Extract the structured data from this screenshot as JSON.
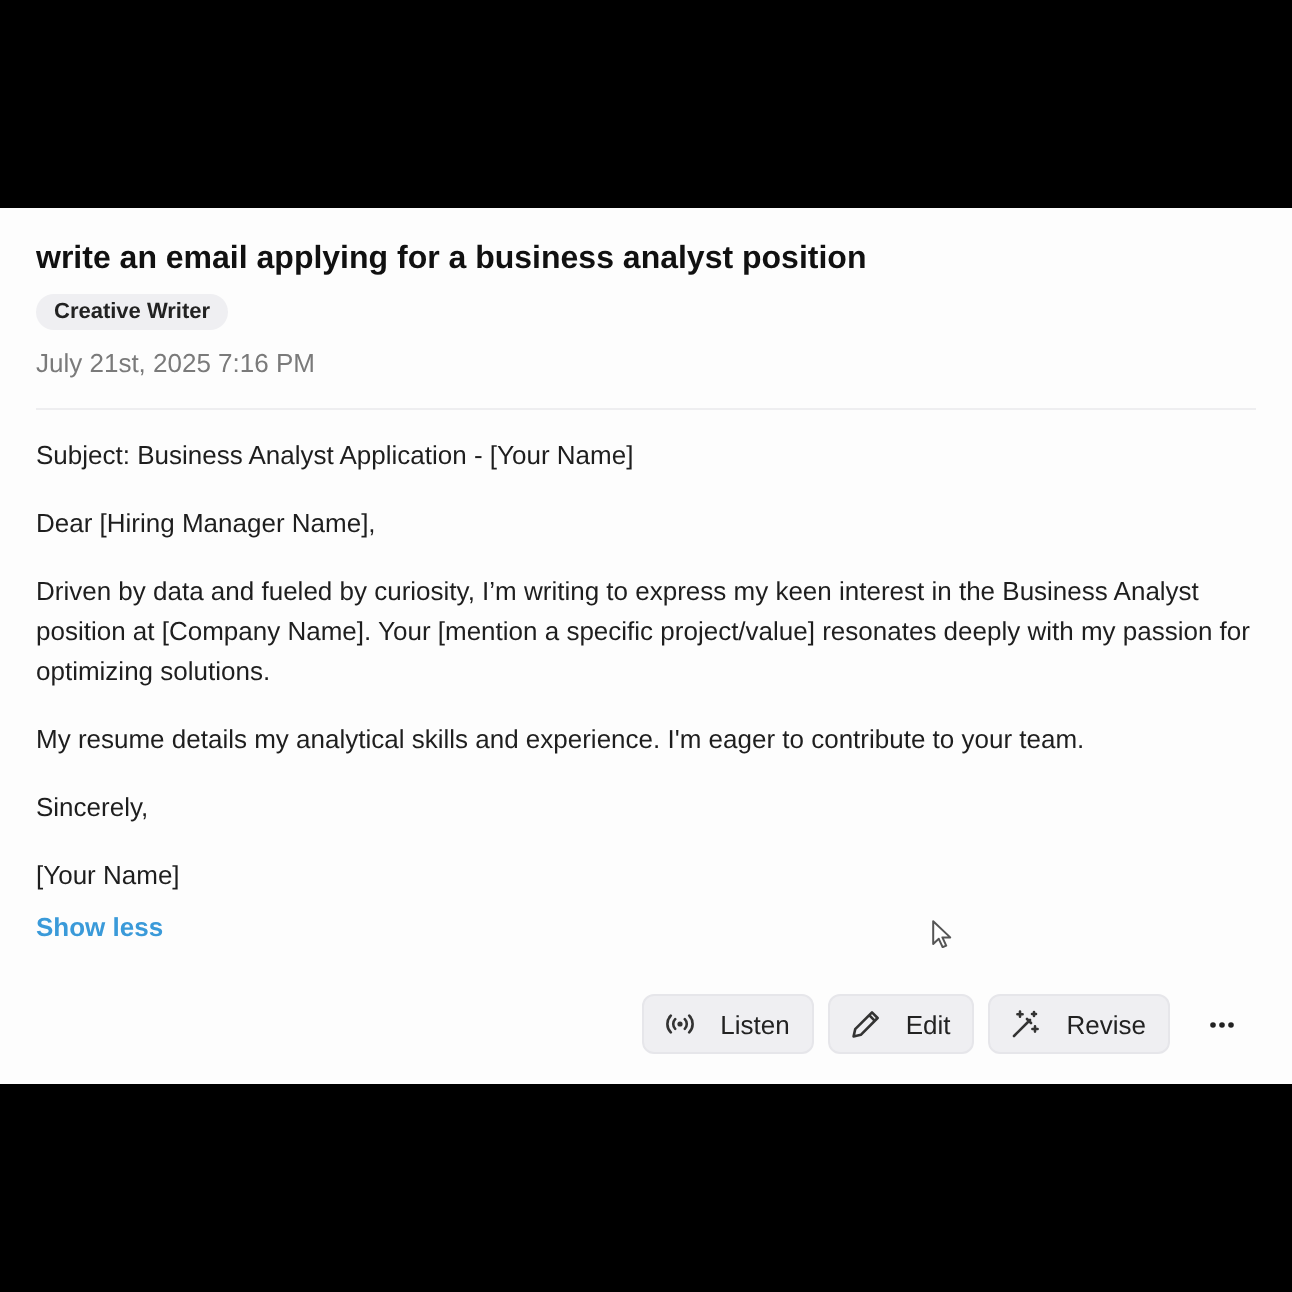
{
  "prompt": {
    "title": "write an email applying for a business analyst position",
    "badge": "Creative Writer",
    "timestamp": "July 21st, 2025 7:16 PM"
  },
  "response": {
    "paragraphs": [
      "Subject: Business Analyst Application - [Your Name]",
      "Dear [Hiring Manager Name],",
      "Driven by data and fueled by curiosity, I’m writing to express my keen interest in the Business Analyst position at [Company Name]. Your [mention a specific project/value] resonates deeply with my passion for optimizing solutions.",
      "My resume details my analytical skills and experience. I'm eager to contribute to your team.",
      "Sincerely,",
      "[Your Name]"
    ],
    "toggle": "Show less"
  },
  "actions": [
    {
      "kind": "listen",
      "label": "Listen"
    },
    {
      "kind": "edit",
      "label": "Edit"
    },
    {
      "kind": "revise",
      "label": "Revise"
    },
    {
      "kind": "more"
    }
  ]
}
